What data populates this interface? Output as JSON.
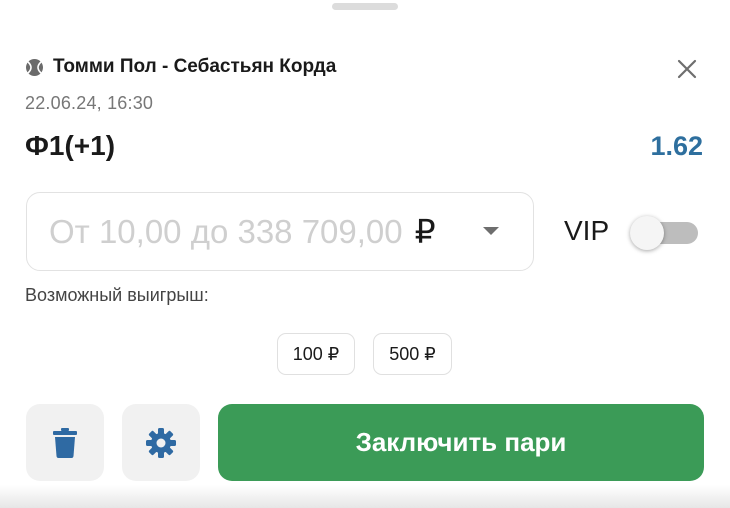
{
  "event": {
    "title": "Томми Пол - Себастьян Корда",
    "date": "22.06.24,  16:30",
    "sport_icon": "tennis-ball-icon"
  },
  "bet": {
    "name": "Ф1(+1)",
    "odds": "1.62"
  },
  "stake": {
    "placeholder": "От 10,00 до 338 709,00",
    "currency": "₽"
  },
  "vip": {
    "label": "VIP",
    "enabled": false
  },
  "payout": {
    "label": "Возможный выигрыш:"
  },
  "quick_amounts": [
    "100 ₽",
    "500 ₽"
  ],
  "actions": {
    "delete_icon": "trash-icon",
    "settings_icon": "gear-icon",
    "submit_label": "Заключить пари"
  },
  "colors": {
    "odds": "#2e6f9e",
    "submit": "#3b9b57",
    "action_icons": "#2f6aa3"
  }
}
